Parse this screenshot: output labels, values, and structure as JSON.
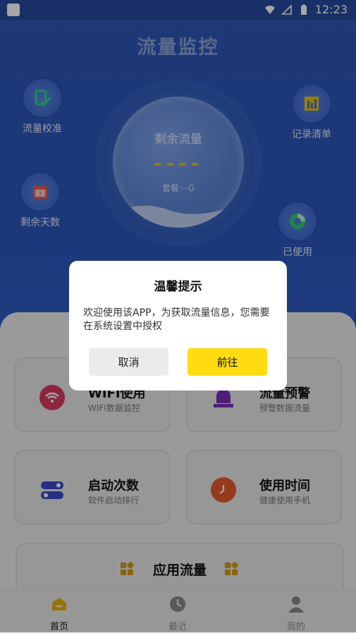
{
  "status": {
    "time": "12:23"
  },
  "header": {
    "title": "流量监控"
  },
  "gauge": {
    "title": "剩余流量",
    "value": "----",
    "package": "套餐:--G"
  },
  "side": {
    "calibrate": "流量校准",
    "records": "记录清单",
    "days": "剩余天数",
    "used": "已使用"
  },
  "cards": [
    {
      "title": "WIFI使用",
      "subtitle": "WIFI数据监控"
    },
    {
      "title": "流量预警",
      "subtitle": "预警数据流量"
    },
    {
      "title": "启动次数",
      "subtitle": "软件启动排行"
    },
    {
      "title": "使用时间",
      "subtitle": "健康使用手机"
    }
  ],
  "app_flow": {
    "label": "应用流量"
  },
  "nav": {
    "home": "首页",
    "recent": "最近",
    "mine": "我的"
  },
  "dialog": {
    "title": "温馨提示",
    "message": "欢迎使用该APP，为获取流量信息，您需要在系统设置中授权",
    "cancel": "取消",
    "confirm": "前往"
  },
  "colors": {
    "accent": "#ffdc10",
    "hero": "#2f58b6",
    "gauge_value": "#e8c30a"
  }
}
